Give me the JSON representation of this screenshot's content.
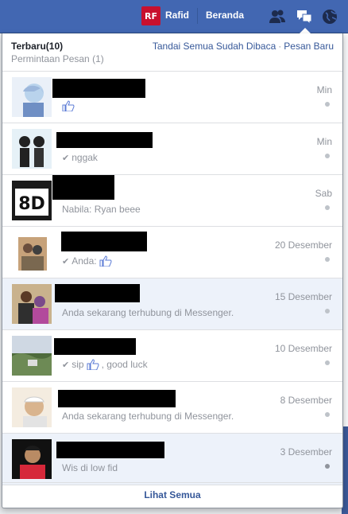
{
  "topbar": {
    "avatar_text": "RF",
    "user_name": "Rafid",
    "home_label": "Beranda"
  },
  "panel": {
    "title": "Terbaru",
    "count": "(10)",
    "requests_label": "Permintaan Pesan",
    "requests_count": "(1)",
    "mark_all_read": "Tandai Semua Sudah Dibaca",
    "separator": "·",
    "new_message": "Pesan Baru",
    "see_all": "Lihat Semua"
  },
  "conversations": [
    {
      "date": "Min",
      "preview": "",
      "has_like": true,
      "sent": false,
      "unread": false
    },
    {
      "date": "Min",
      "preview": "nggak",
      "has_like": false,
      "sent": true,
      "unread": false
    },
    {
      "date": "Sab",
      "preview": "Nabila: Ryan beee",
      "has_like": false,
      "sent": false,
      "unread": false
    },
    {
      "date": "20 Desember",
      "preview": "Anda:",
      "has_like": true,
      "sent": true,
      "unread": false
    },
    {
      "date": "15 Desember",
      "preview": "Anda sekarang terhubung di Messenger.",
      "has_like": false,
      "sent": false,
      "unread": true
    },
    {
      "date": "10 Desember",
      "preview": "sip",
      "preview_after": ", good luck",
      "has_like": true,
      "sent": true,
      "unread": false
    },
    {
      "date": "8 Desember",
      "preview": "Anda sekarang terhubung di Messenger.",
      "has_like": false,
      "sent": false,
      "unread": false
    },
    {
      "date": "3 Desember",
      "preview": "Wis di low fid",
      "has_like": false,
      "sent": false,
      "unread": true
    }
  ],
  "colors": {
    "brand": "#4267b2",
    "link": "#365899",
    "muted": "#90949c",
    "unread_bg": "#edf2fa"
  },
  "icons": [
    "friend-requests-icon",
    "messages-icon",
    "notifications-globe-icon",
    "like-thumb-icon",
    "sent-check-icon",
    "read-dot-icon"
  ]
}
